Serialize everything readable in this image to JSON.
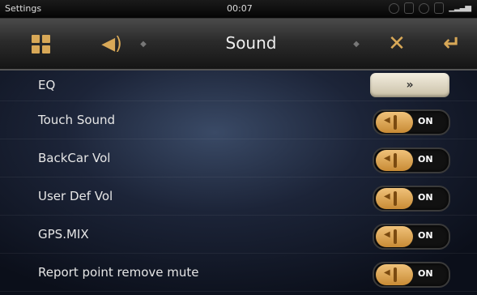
{
  "status": {
    "app": "Settings",
    "time": "00:07",
    "signal": "▁▂▃▅"
  },
  "toolbar": {
    "title": "Sound",
    "icons": [
      "apps-grid-icon",
      "speaker-icon",
      "tools-icon",
      "enter-back-icon"
    ],
    "accent": "#d8a857"
  },
  "rows": [
    {
      "label": "EQ",
      "action": "»"
    },
    {
      "label": "Touch Sound",
      "state": "ON"
    },
    {
      "label": "BackCar Vol",
      "state": "ON"
    },
    {
      "label": "User Def Vol",
      "state": "ON"
    },
    {
      "label": "GPS.MIX",
      "state": "ON"
    },
    {
      "label": "Report point remove mute",
      "state": "ON"
    }
  ]
}
